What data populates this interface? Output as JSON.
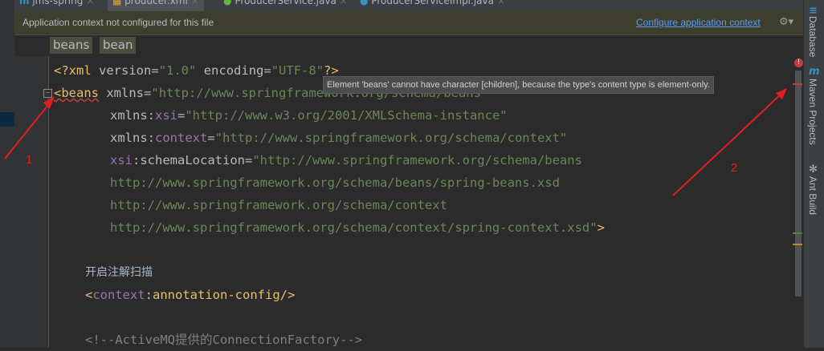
{
  "tabs": [
    {
      "label": "jms-spring"
    },
    {
      "label": "producer.xml"
    },
    {
      "label": "ProducerService.java"
    },
    {
      "label": "ProducerServiceImpl.java"
    }
  ],
  "banner": {
    "message": "Application context not configured for this file",
    "link": "Configure application context"
  },
  "breadcrumbs": [
    "beans",
    "bean"
  ],
  "code": {
    "l1": {
      "open": "<?",
      "tag": "xml",
      "attr1": "version",
      "val1": "\"1.0\"",
      "attr2": "encoding",
      "val2": "\"UTF-8\"",
      "close": "?>"
    },
    "l2": {
      "tag": "<beans",
      "attr": "xmlns",
      "val": "\"http://www.springframework.org/schema/beans\""
    },
    "l3": {
      "attr": "xmlns:",
      "ns": "xsi",
      "val": "\"http://www.w3.org/2001/XMLSchema-instance\""
    },
    "l4": {
      "attr": "xmlns:",
      "ns": "context",
      "val": "\"http://www.springframework.org/schema/context\""
    },
    "l5": {
      "ns": "xsi",
      "attr": ":schemaLocation",
      "val": "\"http://www.springframework.org/schema/beans"
    },
    "l6": "http://www.springframework.org/schema/beans/spring-beans.xsd",
    "l7": "http://www.springframework.org/schema/context",
    "l8": "http://www.springframework.org/schema/context/spring-context.xsd\"",
    "l8_close": ">",
    "l9": "开启注解扫描",
    "l10": {
      "open": "<",
      "ns": "context",
      "colon": ":",
      "tag": "annotation-config",
      "close": "/>"
    },
    "l11": "<!--ActiveMQ提供的ConnectionFactory-->"
  },
  "tooltip": "Element 'beans' cannot have character [children], because the type's content type is element-only.",
  "error_badge": "!",
  "right_tools": [
    {
      "label": "Database",
      "icon": "database-icon"
    },
    {
      "label": "Maven Projects",
      "icon": "maven-icon",
      "glyph": "m"
    },
    {
      "label": "Ant Build",
      "icon": "ant-icon",
      "glyph": "✻"
    }
  ],
  "annotations": [
    "1",
    "2"
  ],
  "colors": {
    "background": "#2b2b2b",
    "annotation": "#e02020",
    "link": "#589df6"
  }
}
